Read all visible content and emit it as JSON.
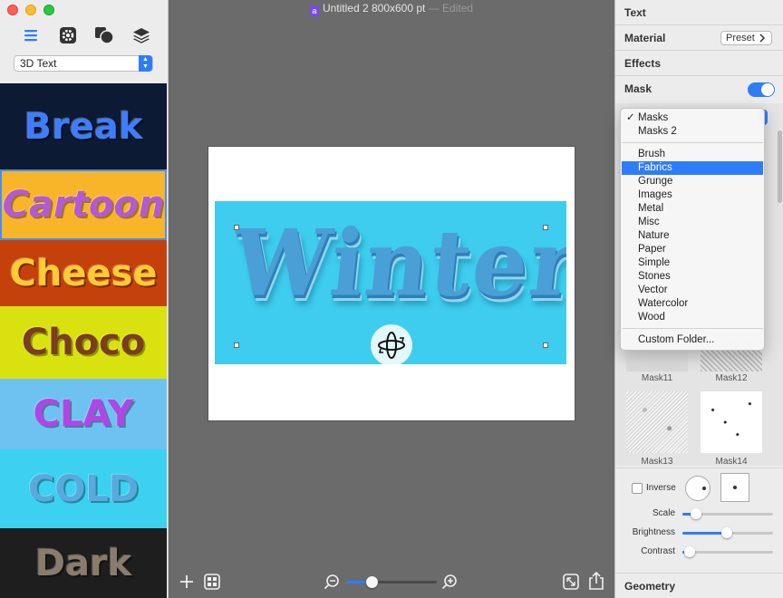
{
  "sidebar": {
    "modes": [
      {
        "icon": "list-icon"
      },
      {
        "icon": "gear-icon"
      },
      {
        "icon": "shapes-icon"
      },
      {
        "icon": "layers-icon"
      }
    ],
    "category_select": "3D Text",
    "presets": [
      {
        "label": "Break",
        "bg": "#0c1a33",
        "color": "#3f7dff"
      },
      {
        "label": "Cartoon",
        "bg": "#f8b52a",
        "color": "#b25ad6"
      },
      {
        "label": "Cheese",
        "bg": "#c5410c",
        "color": "#ffcc33"
      },
      {
        "label": "Choco",
        "bg": "#d9e20e",
        "color": "#7a3d1f"
      },
      {
        "label": "CLAY",
        "bg": "#6ec2f2",
        "color": "#b245e8"
      },
      {
        "label": "COLD",
        "bg": "#3cd0f1",
        "color": "#5aa9dc"
      },
      {
        "label": "Dark",
        "bg": "#1e1e1e",
        "color": "#8a7c6c"
      }
    ]
  },
  "canvas": {
    "doc_title": "Untitled 2 800x600 pt",
    "doc_status": "— Edited",
    "art_text": "Winter",
    "art_bg": "#3ecdee"
  },
  "bottom_toolbar": {
    "zoom_value": 0.28
  },
  "inspector": {
    "sections": {
      "text": "Text",
      "material": "Material",
      "effects": "Effects",
      "mask": "Mask",
      "geometry": "Geometry"
    },
    "preset_button": "Preset",
    "mask_enabled": true,
    "thumbnails": [
      {
        "label": "Mask11"
      },
      {
        "label": "Mask12"
      },
      {
        "label": "Mask13"
      },
      {
        "label": "Mask14"
      }
    ],
    "inverse_label": "Inverse",
    "sliders": {
      "scale": {
        "label": "Scale",
        "value": 0.15
      },
      "brightness": {
        "label": "Brightness",
        "value": 0.49
      },
      "contrast": {
        "label": "Contrast",
        "value": 0.08
      }
    }
  },
  "mask_menu": {
    "group1": [
      {
        "label": "Masks",
        "checked": true
      },
      {
        "label": "Masks 2",
        "checked": false
      }
    ],
    "group2": [
      {
        "label": "Brush"
      },
      {
        "label": "Fabrics",
        "highlighted": true
      },
      {
        "label": "Grunge"
      },
      {
        "label": "Images"
      },
      {
        "label": "Metal"
      },
      {
        "label": "Misc"
      },
      {
        "label": "Nature"
      },
      {
        "label": "Paper"
      },
      {
        "label": "Simple"
      },
      {
        "label": "Stones"
      },
      {
        "label": "Vector"
      },
      {
        "label": "Watercolor"
      },
      {
        "label": "Wood"
      }
    ],
    "custom": "Custom Folder..."
  }
}
